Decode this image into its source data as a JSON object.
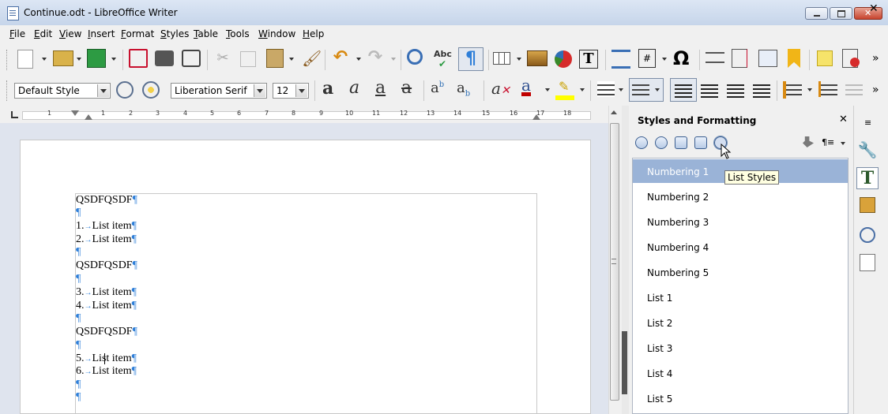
{
  "window": {
    "title": "Continue.odt - LibreOffice Writer"
  },
  "menu": {
    "items": [
      {
        "label": "File",
        "access": "F",
        "rest": "ile"
      },
      {
        "label": "Edit",
        "access": "E",
        "rest": "dit"
      },
      {
        "label": "View",
        "access": "V",
        "rest": "iew"
      },
      {
        "label": "Insert",
        "access": "I",
        "rest": "nsert"
      },
      {
        "label": "Format",
        "access": "F",
        "rest": "ormat"
      },
      {
        "label": "Styles",
        "access": "S",
        "rest": "tyles"
      },
      {
        "label": "Table",
        "access": "T",
        "rest": "able"
      },
      {
        "label": "Tools",
        "access": "T",
        "rest": "ools"
      },
      {
        "label": "Window",
        "access": "W",
        "rest": "indow"
      },
      {
        "label": "Help",
        "access": "H",
        "rest": "elp"
      }
    ],
    "close_symbol": "✕"
  },
  "formatting": {
    "paragraph_style": "Default Style",
    "font_name": "Liberation Serif",
    "font_size": "12"
  },
  "ruler": {
    "numbers": [
      "1",
      "1",
      "2",
      "3",
      "4",
      "5",
      "6",
      "7",
      "8",
      "9",
      "10",
      "11",
      "12",
      "13",
      "14",
      "15",
      "16",
      "17",
      "18"
    ]
  },
  "document": {
    "lines": [
      {
        "num": "",
        "text": "QSDFQSDF"
      },
      {
        "num": "",
        "text": ""
      },
      {
        "num": "1.",
        "text": "List item"
      },
      {
        "num": "2.",
        "text": "List item"
      },
      {
        "num": "",
        "text": ""
      },
      {
        "num": "",
        "text": "QSDFQSDF"
      },
      {
        "num": "",
        "text": ""
      },
      {
        "num": "3.",
        "text": "List item"
      },
      {
        "num": "4.",
        "text": "List item"
      },
      {
        "num": "",
        "text": ""
      },
      {
        "num": "",
        "text": "QSDFQSDF"
      },
      {
        "num": "",
        "text": ""
      },
      {
        "num": "5.",
        "text": "List item"
      },
      {
        "num": "6.",
        "text": "List item"
      },
      {
        "num": "",
        "text": ""
      },
      {
        "num": "",
        "text": ""
      }
    ],
    "pilcrow": "¶",
    "tab_mark": "→"
  },
  "sidebar": {
    "title": "Styles and Formatting",
    "close_symbol": "✕",
    "tooltip": "List Styles",
    "fill_format_symbol": "¶≡",
    "styles": [
      "Numbering 1",
      "Numbering 2",
      "Numbering 3",
      "Numbering 4",
      "Numbering 5",
      "List 1",
      "List 2",
      "List 3",
      "List 4",
      "List 5"
    ],
    "selected_index": 0
  },
  "toolbar": {
    "more_symbol": "»",
    "special_char": "Ω",
    "formatting_marks": "¶",
    "spellcheck_text": "Abc",
    "textbox_letter": "T"
  },
  "colors": {
    "accent": "#2f7fd8",
    "selection": "#9ab3d7",
    "font_color": "#c00000",
    "highlight": "#ffff00"
  }
}
